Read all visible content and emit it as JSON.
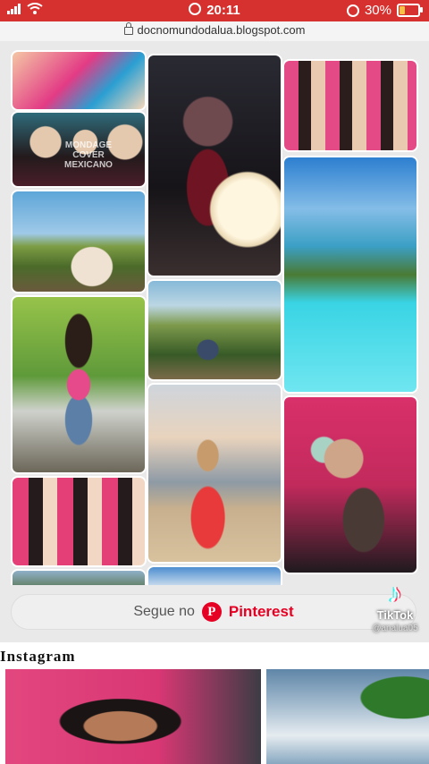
{
  "status_bar": {
    "time": "20:11",
    "battery": "30%",
    "battery_level": 0.3,
    "icons": [
      "cellular-icon",
      "wifi-icon",
      "alarm-icon",
      "charging-icon"
    ]
  },
  "url_bar": {
    "url": "docnomundodalua.blogspot.com"
  },
  "pins": [
    {
      "caption": ""
    },
    {
      "caption": "MONDAGE COVER MEXICANO"
    },
    {
      "caption": ""
    },
    {
      "caption": ""
    },
    {
      "caption": ""
    },
    {
      "caption": ""
    },
    {
      "caption": ""
    },
    {
      "caption": ""
    },
    {
      "caption": ""
    },
    {
      "caption": ""
    },
    {
      "caption": ""
    }
  ],
  "follow": {
    "label": "Segue no",
    "brand": "Pinterest",
    "logo_letter": "P"
  },
  "tiktok": {
    "name": "TikTok",
    "username": "@analua05"
  },
  "instagram": {
    "title": "Instagram"
  },
  "colors": {
    "status_bar": "#d6312f",
    "pinterest_red": "#e60023",
    "widget_bg": "#e9e9e9"
  }
}
